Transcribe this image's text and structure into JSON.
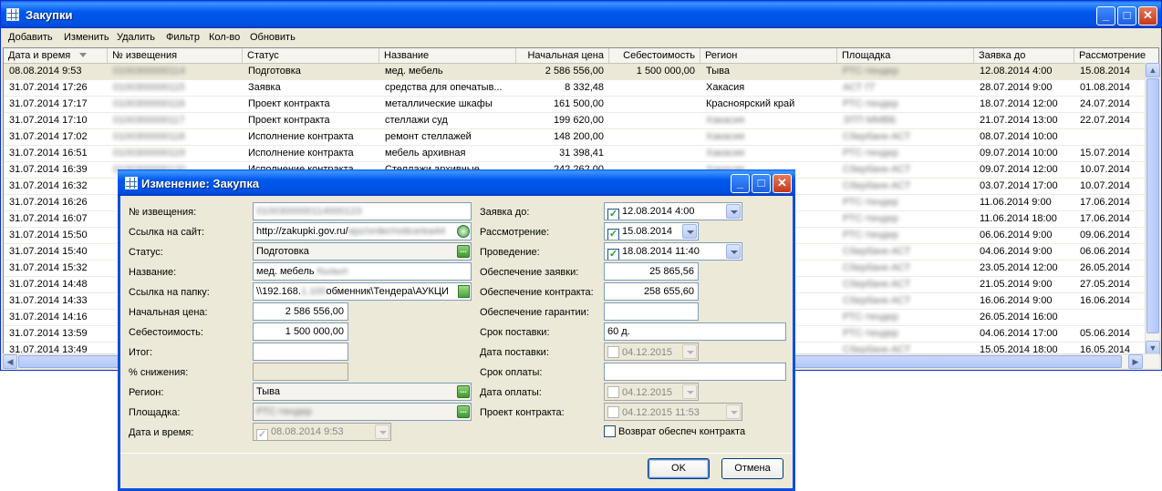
{
  "main": {
    "title": "Закупки",
    "menu": [
      "Добавить",
      "Изменить",
      "Удалить",
      "Фильтр",
      "Кол-во",
      "Обновить"
    ],
    "columns": [
      "Дата и время",
      "№ извещения",
      "Статус",
      "Название",
      "Начальная цена",
      "Себестоимость",
      "Регион",
      "Площадка",
      "Заявка до",
      "Рассмотрение"
    ],
    "rows": [
      [
        "08.08.2014 9:53",
        "0100300000114",
        "Подготовка",
        "мед. мебель ",
        "2 586 556,00",
        "1 500 000,00",
        "Тыва",
        "РТС-тендер",
        "12.08.2014 4:00",
        "15.08.2014"
      ],
      [
        "31.07.2014 17:26",
        "0100300000115",
        "Заявка",
        "средства для опечатыв...",
        "8 332,48",
        "",
        "Хакасия",
        "АСТ ГГ",
        "28.07.2014 9:00",
        "01.08.2014"
      ],
      [
        "31.07.2014 17:17",
        "0100300000116",
        "Проект контракта",
        "металлические шкафы",
        "161 500,00",
        "",
        "Красноярский край",
        "РТС-тендер",
        "18.07.2014 12:00",
        "24.07.2014"
      ],
      [
        "31.07.2014 17:10",
        "0100300000117",
        "Проект контракта",
        "стеллажи суд",
        "199 620,00",
        "",
        "Хакасия",
        "ЭТП ММВБ",
        "21.07.2014 13:00",
        "22.07.2014"
      ],
      [
        "31.07.2014 17:02",
        "0100300000118",
        "Исполнение контракта",
        "ремонт стеллажей",
        "148 200,00",
        "",
        "Хакасия",
        "Сбербанк-АСТ",
        "08.07.2014 10:00",
        ""
      ],
      [
        "31.07.2014 16:51",
        "0100300000119",
        "Исполнение контракта",
        "мебель архивная",
        "31 398,41",
        "",
        "Хакасия",
        "РТС-тендер",
        "09.07.2014 10:00",
        "15.07.2014"
      ],
      [
        "31.07.2014 16:39",
        "0100300000120",
        "Исполнение контракта",
        "Стеллажи архивные",
        "242 262,00",
        "",
        "Хакасия",
        "Сбербанк-АСТ",
        "09.07.2014 12:00",
        "10.07.2014"
      ],
      [
        "31.07.2014 16:32",
        "",
        "",
        "",
        "",
        "",
        "",
        "Сбербанк-АСТ",
        "03.07.2014 17:00",
        "10.07.2014"
      ],
      [
        "31.07.2014 16:26",
        "",
        "",
        "",
        "",
        "",
        "",
        "РТС-тендер",
        "11.06.2014 9:00",
        "17.06.2014"
      ],
      [
        "31.07.2014 16:07",
        "",
        "",
        "",
        "",
        "",
        "",
        "РТС-тендер",
        "11.06.2014 18:00",
        "17.06.2014"
      ],
      [
        "31.07.2014 15:50",
        "",
        "",
        "",
        "",
        "",
        "",
        "РТС-тендер",
        "06.06.2014 9:00",
        "09.06.2014"
      ],
      [
        "31.07.2014 15:40",
        "",
        "",
        "",
        "",
        "",
        "",
        "Сбербанк-АСТ",
        "04.06.2014 9:00",
        "06.06.2014"
      ],
      [
        "31.07.2014 15:32",
        "",
        "",
        "",
        "",
        "",
        "",
        "Сбербанк-АСТ",
        "23.05.2014 12:00",
        "26.05.2014"
      ],
      [
        "31.07.2014 14:48",
        "",
        "",
        "",
        "",
        "",
        "",
        "Сбербанк-АСТ",
        "21.05.2014 9:00",
        "27.05.2014"
      ],
      [
        "31.07.2014 14:33",
        "",
        "",
        "",
        "",
        "",
        "",
        "Сбербанк-АСТ",
        "16.06.2014 9:00",
        "16.06.2014"
      ],
      [
        "31.07.2014 14:16",
        "",
        "",
        "",
        "",
        "",
        "",
        "РТС-тендер",
        "26.05.2014 16:00",
        ""
      ],
      [
        "31.07.2014 13:59",
        "",
        "",
        "",
        "",
        "",
        "",
        "РТС-тендер",
        "04.06.2014 17:00",
        "05.06.2014"
      ],
      [
        "31.07.2014 13:49",
        "",
        "",
        "",
        "",
        "",
        "",
        "Сбербанк-АСТ",
        "15.05.2014 18:00",
        "16.05.2014"
      ]
    ]
  },
  "dialog": {
    "title": "Изменение: Закупка",
    "labels": {
      "notice": "№ извещения:",
      "site_link": "Ссылка на сайт:",
      "status": "Статус:",
      "name": "Название:",
      "folder_link": "Ссылка на папку:",
      "start_price": "Начальная цена:",
      "cost": "Себестоимость:",
      "total": "Итог:",
      "reduction": "% снижения:",
      "region": "Регион:",
      "platform": "Площадка:",
      "datetime": "Дата и время:",
      "bid_until": "Заявка до:",
      "review": "Рассмотрение:",
      "conduct": "Проведение:",
      "bid_security": "Обеспечение заявки:",
      "contract_security": "Обеспечение контракта:",
      "warranty_security": "Обеспечение гарантии:",
      "delivery_term": "Срок поставки:",
      "delivery_date": "Дата поставки:",
      "payment_term": "Срок оплаты:",
      "payment_date": "Дата оплаты:",
      "draft_contract": "Проект контракта:"
    },
    "values": {
      "notice": "0100300000114000123",
      "site_link_prefix": "http://zakupki.gov.ru/",
      "site_link_hidden": "epz/order/notice/ea44",
      "status": "Подготовка",
      "name": "мед. мебель ",
      "name_hidden": "Кызыл",
      "folder_prefix": "\\\\192.168.",
      "folder_hidden": "1.100",
      "folder_suffix": "обменник\\Тендера\\АУКЦИ",
      "start_price": "2 586 556,00",
      "cost": "1 500 000,00",
      "total": "",
      "reduction": "",
      "region": "Тыва",
      "platform": "РТС-тендер",
      "datetime": "08.08.2014   9:53",
      "bid_until": "12.08.2014   4:00",
      "review": "15.08.2014",
      "conduct": "18.08.2014 11:40",
      "bid_security": "25 865,56",
      "contract_security": "258 655,60",
      "warranty_security": "",
      "delivery_term": "60 д.",
      "delivery_date": "04.12.2015",
      "payment_term": "",
      "payment_date": "04.12.2015",
      "draft_contract": "04.12.2015 11:53"
    },
    "return_security_label": "Возврат обеспеч контракта",
    "ok_label": "OK",
    "cancel_label": "Отмена"
  },
  "icons": {
    "check": "✓",
    "ellipsis": "..."
  }
}
